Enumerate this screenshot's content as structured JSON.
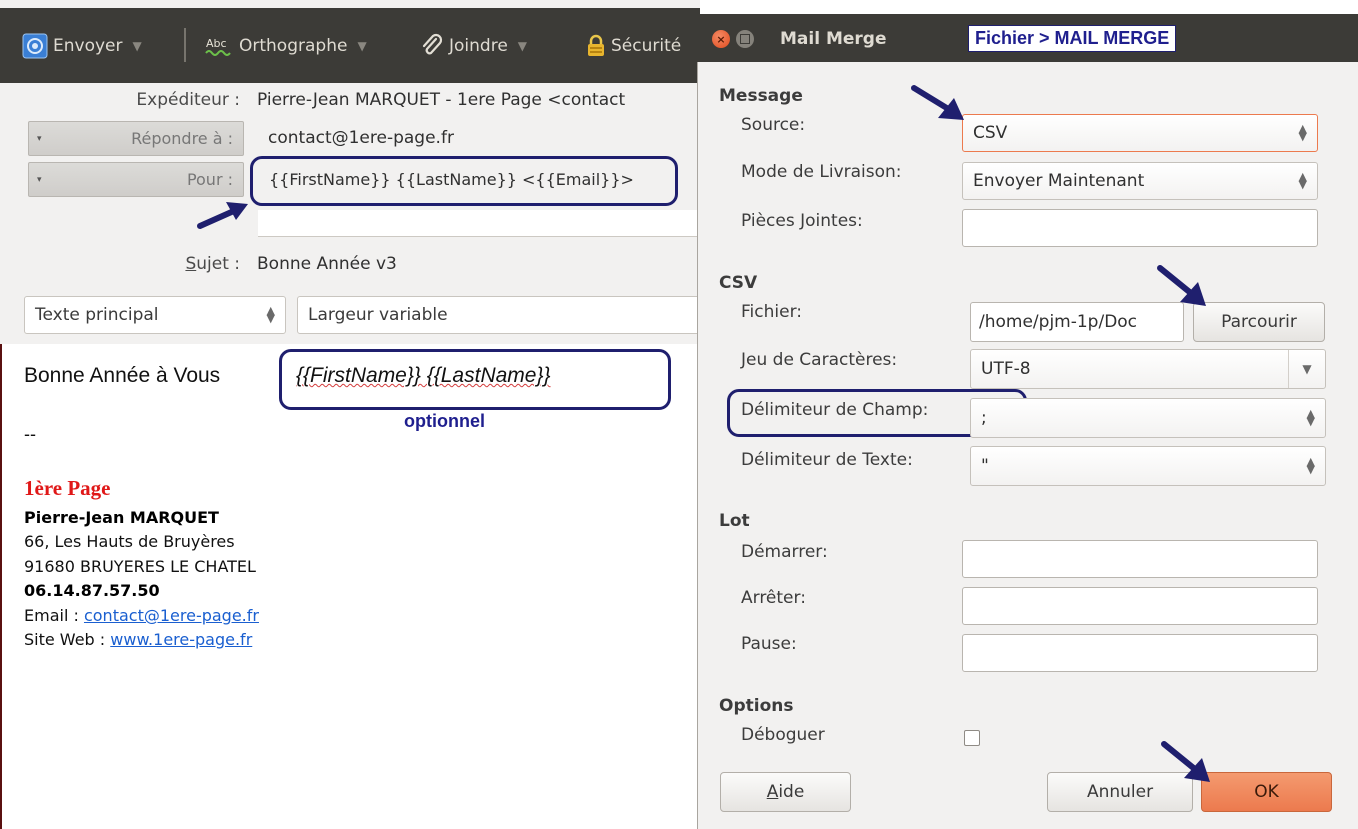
{
  "compose": {
    "toolbar": {
      "send": "Envoyer",
      "spelling": "Orthographe",
      "attach": "Joindre",
      "security": "Sécurité"
    },
    "headers": {
      "from_label": "Expéditeur :",
      "from_value": "Pierre-Jean MARQUET - 1ere Page <contact",
      "reply_to_label": "Répondre à :",
      "reply_to_value": "contact@1ere-page.fr",
      "to_label": "Pour :",
      "to_value": "{{FirstName}} {{LastName}} <{{Email}}>",
      "subject_label": "Sujet :",
      "subject_value": "Bonne Année v3"
    },
    "format": {
      "paragraph": "Texte principal",
      "font": "Largeur variable"
    },
    "body": {
      "greeting": "Bonne Année à Vous",
      "greeting_vars": "{{FirstName}} {{LastName}}",
      "optional_note": "optionnel",
      "separator": "--",
      "company": "1ère Page",
      "signature_name": "Pierre-Jean MARQUET",
      "address1": "66, Les Hauts de Bruyères",
      "address2": "91680 BRUYERES LE CHATEL",
      "phone": "06.14.87.57.50",
      "email_label": "Email :",
      "email_link": "contact@1ere-page.fr",
      "web_label": "Site Web :",
      "web_link": "www.1ere-page.fr"
    }
  },
  "dialog": {
    "title": "Mail Merge",
    "annotation": "Fichier > MAIL MERGE",
    "message": {
      "heading": "Message",
      "source_label": "Source:",
      "source_value": "CSV",
      "delivery_label": "Mode de Livraison:",
      "delivery_value": "Envoyer Maintenant",
      "attachments_label": "Pièces Jointes:",
      "attachments_value": ""
    },
    "csv": {
      "heading": "CSV",
      "file_label": "Fichier:",
      "file_value": "/home/pjm-1p/Doc",
      "browse": "Parcourir",
      "charset_label": "Jeu de Caractères:",
      "charset_value": "UTF-8",
      "field_delim_label": "Délimiteur de Champ:",
      "field_delim_value": ";",
      "text_delim_label": "Délimiteur de Texte:",
      "text_delim_value": "\""
    },
    "batch": {
      "heading": "Lot",
      "start_label": "Démarrer:",
      "stop_label": "Arrêter:",
      "pause_label": "Pause:"
    },
    "options": {
      "heading": "Options",
      "debug_label": "Déboguer",
      "debug_checked": false
    },
    "buttons": {
      "help": "Aide",
      "cancel": "Annuler",
      "ok": "OK"
    }
  },
  "colors": {
    "annotation": "#1f1f6e",
    "ok_button": "#ec7a4e",
    "company": "#e01818"
  }
}
